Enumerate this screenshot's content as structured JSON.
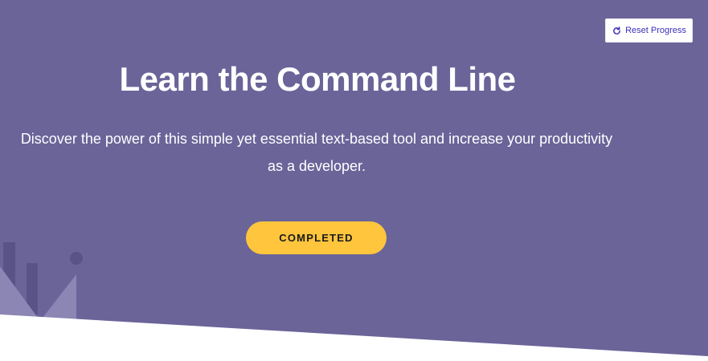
{
  "header": {
    "reset_button": {
      "label": "Reset Progress",
      "icon": "refresh-icon"
    }
  },
  "hero": {
    "title": "Learn the Command Line",
    "description": "Discover the power of this simple yet essential text-based tool and increase your productivity as a developer.",
    "status_button_label": "COMPLETED"
  },
  "colors": {
    "background": "#6a6499",
    "accent": "#fec53d",
    "reset_text": "#3b2fb8"
  }
}
